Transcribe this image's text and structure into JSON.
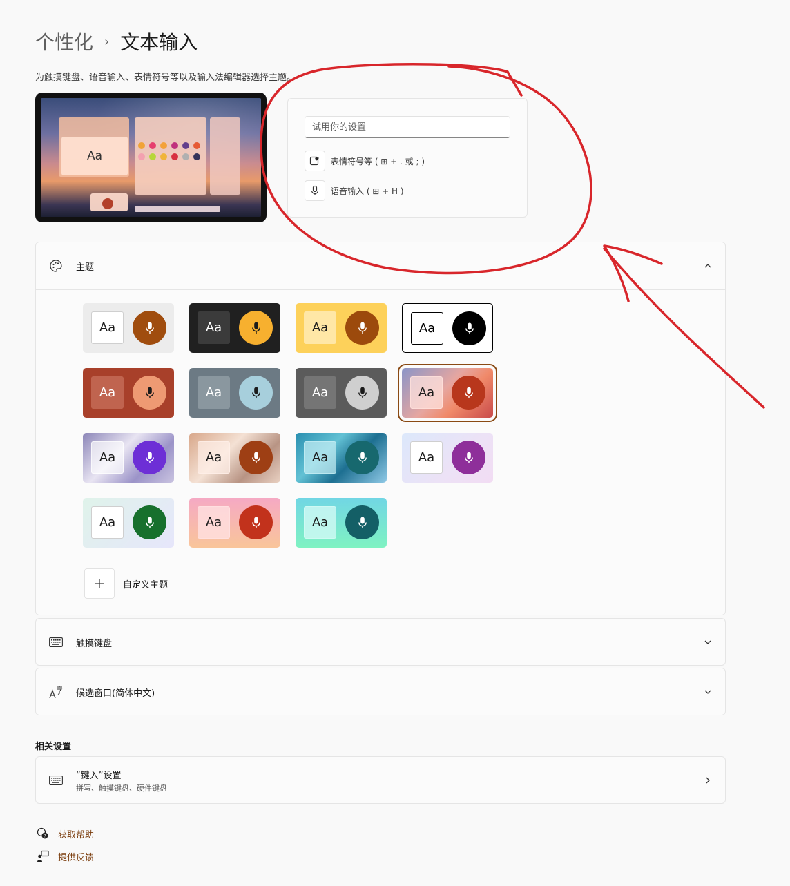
{
  "breadcrumb": {
    "parent": "个性化",
    "separator": "›",
    "current": "文本输入"
  },
  "description": "为触摸键盘、语音输入、表情符号等以及输入法编辑器选择主题。",
  "preview": {
    "sample_text": "Aa"
  },
  "tryout": {
    "placeholder": "试用你的设置",
    "emoji_hint": "表情符号等 ( ⊞ + . 或 ; )",
    "voice_hint": "语音输入 ( ⊞ + H )"
  },
  "theme_section": {
    "title": "主题",
    "tile_label": "Aa",
    "custom_label": "自定义主题",
    "tiles": [
      {
        "name": "light",
        "bg": "#ececec",
        "aa_bg": "#ffffff",
        "aa_fg": "#1b1b1b",
        "aa_border": "#cfcfcf",
        "mic_bg": "#a04d0e",
        "mic_fg": "#ffffff"
      },
      {
        "name": "dark",
        "bg": "#202020",
        "aa_bg": "#3b3b3b",
        "aa_fg": "#ffffff",
        "aa_border": "#3b3b3b",
        "mic_bg": "#f7b02f",
        "mic_fg": "#1b1b1b"
      },
      {
        "name": "yellow",
        "bg": "#fdd15a",
        "aa_bg": "#ffe7a6",
        "aa_fg": "#1b1b1b",
        "aa_border": "#ffe7a6",
        "mic_bg": "#9c4a0c",
        "mic_fg": "#ffffff"
      },
      {
        "name": "high-contrast",
        "bg": "#ffffff",
        "aa_bg": "#ffffff",
        "aa_fg": "#000000",
        "aa_border": "#000000",
        "mic_bg": "#000000",
        "mic_fg": "#ffffff",
        "border": "#000000"
      },
      {
        "name": "rust",
        "bg": "#a8402a",
        "aa_bg": "#c0644f",
        "aa_fg": "#ffffff",
        "aa_border": "#c0644f",
        "mic_bg": "#ee9a73",
        "mic_fg": "#1b1b1b"
      },
      {
        "name": "slate",
        "bg": "#6c7a84",
        "aa_bg": "#8a979f",
        "aa_fg": "#ffffff",
        "aa_border": "#8a979f",
        "mic_bg": "#a7cfdc",
        "mic_fg": "#1b1b1b"
      },
      {
        "name": "graphite",
        "bg": "#5b5b5b",
        "aa_bg": "#757575",
        "aa_fg": "#ffffff",
        "aa_border": "#757575",
        "mic_bg": "#cfcfcf",
        "mic_fg": "#1b1b1b"
      },
      {
        "name": "sunset-selected",
        "bg": "linear-gradient(135deg,#8a95c8 0%,#e6a6a0 45%,#f08a6a 65%,#c94a4a 100%)",
        "aa_bg": "rgba(255,225,220,0.75)",
        "aa_fg": "#1b1b1b",
        "aa_border": "rgba(255,225,220,0.75)",
        "mic_bg": "#b8371c",
        "mic_fg": "#ffffff",
        "selected": true
      },
      {
        "name": "lavender-wave",
        "bg": "linear-gradient(135deg,#8c86b8 0%,#e8e4f2 40%,#9b93c8 70%,#c9c3e0 100%)",
        "aa_bg": "rgba(255,255,255,0.65)",
        "aa_fg": "#1b1b1b",
        "aa_border": "rgba(255,255,255,0.65)",
        "mic_bg": "#6d2fd6",
        "mic_fg": "#ffffff"
      },
      {
        "name": "sand-wave",
        "bg": "linear-gradient(135deg,#d8a78a 0%,#f4e1d4 40%,#b89484 70%,#e9d1c2 100%)",
        "aa_bg": "rgba(255,240,232,0.7)",
        "aa_fg": "#1b1b1b",
        "aa_border": "rgba(255,240,232,0.7)",
        "mic_bg": "#9e3f14",
        "mic_fg": "#ffffff"
      },
      {
        "name": "ocean",
        "bg": "linear-gradient(135deg,#2a8fb0 0%,#62c1d4 35%,#1d6f91 60%,#8fc9e6 100%)",
        "aa_bg": "rgba(200,240,245,0.7)",
        "aa_fg": "#1b1b1b",
        "aa_border": "rgba(200,240,245,0.7)",
        "mic_bg": "#17686e",
        "mic_fg": "#ffffff"
      },
      {
        "name": "orchid",
        "bg": "linear-gradient(135deg,#dce8fb 0%,#ece2f6 60%,#f2dcf3 100%)",
        "aa_bg": "#ffffff",
        "aa_fg": "#1b1b1b",
        "aa_border": "#cfcfcf",
        "mic_bg": "#8e2f9a",
        "mic_fg": "#ffffff"
      },
      {
        "name": "mint",
        "bg": "linear-gradient(135deg,#dff3ea 0%,#e6e6fb 100%)",
        "aa_bg": "#ffffff",
        "aa_fg": "#1b1b1b",
        "aa_border": "#cfcfcf",
        "mic_bg": "#17702d",
        "mic_fg": "#ffffff"
      },
      {
        "name": "peach",
        "bg": "linear-gradient(180deg,#f5a9c4 0%,#f9c59a 100%)",
        "aa_bg": "rgba(255,225,225,0.8)",
        "aa_fg": "#1b1b1b",
        "aa_border": "rgba(255,225,225,0.8)",
        "mic_bg": "#c2321c",
        "mic_fg": "#ffffff"
      },
      {
        "name": "aqua",
        "bg": "linear-gradient(180deg,#71d6e4 0%,#7ff2c2 100%)",
        "aa_bg": "rgba(210,250,245,0.8)",
        "aa_fg": "#1b1b1b",
        "aa_border": "rgba(210,250,245,0.8)",
        "mic_bg": "#145f66",
        "mic_fg": "#ffffff"
      }
    ]
  },
  "touch_keyboard": {
    "title": "触摸键盘"
  },
  "candidate_window": {
    "title": "候选窗口(简体中文)"
  },
  "related": {
    "title": "相关设置",
    "typing_title": "“键入”设置",
    "typing_sub": "拼写、触摸键盘、硬件键盘"
  },
  "links": {
    "help": "获取帮助",
    "feedback": "提供反馈"
  },
  "colors": {
    "accent": "#8a4a14",
    "annotation": "#d8262b"
  }
}
